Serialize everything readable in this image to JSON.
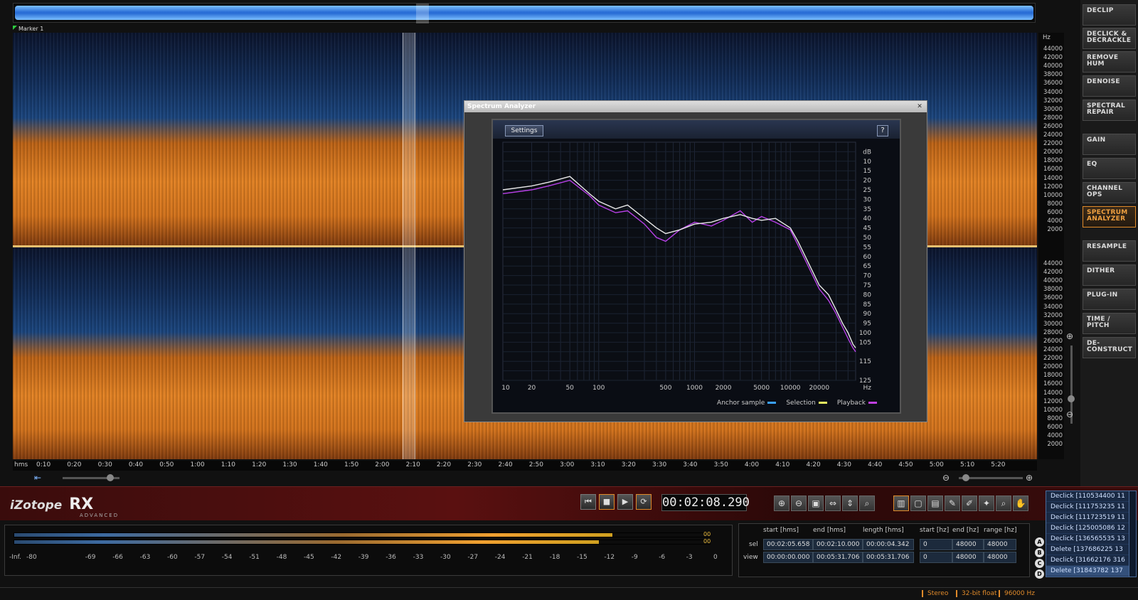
{
  "marker": {
    "label": "Marker 1"
  },
  "hz_scale": {
    "unit": "Hz",
    "ticks": [
      "44000",
      "42000",
      "40000",
      "38000",
      "36000",
      "34000",
      "32000",
      "30000",
      "28000",
      "26000",
      "24000",
      "22000",
      "20000",
      "18000",
      "16000",
      "14000",
      "12000",
      "10000",
      "8000",
      "6000",
      "4000",
      "2000"
    ]
  },
  "timeline": {
    "unit": "hms",
    "ticks": [
      "0:10",
      "0:20",
      "0:30",
      "0:40",
      "0:50",
      "1:00",
      "1:10",
      "1:20",
      "1:30",
      "1:40",
      "1:50",
      "2:00",
      "2:10",
      "2:20",
      "2:30",
      "2:40",
      "2:50",
      "3:00",
      "3:10",
      "3:20",
      "3:30",
      "3:40",
      "3:50",
      "4:00",
      "4:10",
      "4:20",
      "4:30",
      "4:40",
      "4:50",
      "5:00",
      "5:10",
      "5:20"
    ]
  },
  "modules": [
    {
      "label": "DECLIP"
    },
    {
      "label": "DECLICK & DECRACKLE"
    },
    {
      "label": "REMOVE HUM"
    },
    {
      "label": "DENOISE"
    },
    {
      "label": "SPECTRAL REPAIR"
    },
    {
      "label": "GAIN"
    },
    {
      "label": "EQ"
    },
    {
      "label": "CHANNEL OPS"
    },
    {
      "label": "SPECTRUM ANALYZER",
      "active": true
    },
    {
      "label": "RESAMPLE"
    },
    {
      "label": "DITHER"
    },
    {
      "label": "PLUG-IN"
    },
    {
      "label": "TIME / PITCH"
    },
    {
      "label": "DE-CONSTRUCT"
    }
  ],
  "branding": {
    "brand": "iZotope",
    "product": "RX",
    "edition": "ADVANCED"
  },
  "transport": {
    "time": "00:02:08.290"
  },
  "meter": {
    "ticks": [
      "-Inf.",
      "-80",
      "-69",
      "-66",
      "-63",
      "-60",
      "-57",
      "-54",
      "-51",
      "-48",
      "-45",
      "-42",
      "-39",
      "-36",
      "-33",
      "-30",
      "-27",
      "-24",
      "-21",
      "-18",
      "-15",
      "-12",
      "-9",
      "-6",
      "-3",
      "0"
    ],
    "peak_left": "00",
    "peak_right": "00",
    "level_left": 0.86,
    "level_right": 0.84
  },
  "selection_info": {
    "headers": {
      "start_hms": "start [hms]",
      "end_hms": "end [hms]",
      "length_hms": "length [hms]",
      "start_hz": "start [hz]",
      "end_hz": "end [hz]",
      "range_hz": "range [hz]"
    },
    "sel": {
      "label": "sel",
      "start": "00:02:05.658",
      "end": "00:02:10.000",
      "length": "00:00:04.342",
      "start_hz": "0",
      "end_hz": "48000",
      "range_hz": "48000"
    },
    "view": {
      "label": "view",
      "start": "00:00:00.000",
      "end": "00:05:31.706",
      "length": "00:05:31.706",
      "start_hz": "0",
      "end_hz": "48000",
      "range_hz": "48000"
    }
  },
  "abcd": [
    "A",
    "B",
    "C",
    "D"
  ],
  "history": [
    "Declick [110534400 11",
    "Declick [111753235 11",
    "Declick [111723519 11",
    "Declick [125005086 12",
    "Declick [136565535 13",
    "Delete [137686225 13",
    "Declick [31662176 316",
    "Delete [31843782 137"
  ],
  "status": {
    "channels": "Stereo",
    "bitdepth": "32-bit float",
    "samplerate": "96000 Hz"
  },
  "spectrum_analyzer": {
    "title": "Spectrum Analyzer",
    "settings_label": "Settings",
    "help_label": "?",
    "legend": [
      {
        "label": "Anchor sample",
        "color": "#3aa0ff"
      },
      {
        "label": "Selection",
        "color": "#e8f060"
      },
      {
        "label": "Playback",
        "color": "#c040e0"
      }
    ]
  },
  "chart_data": {
    "type": "line",
    "x_scale": "log",
    "x_unit": "Hz",
    "y_unit": "dB",
    "xlim": [
      10,
      48000
    ],
    "ylim": [
      0,
      125
    ],
    "x_tick_labels": [
      "10",
      "20",
      "50",
      "100",
      "500",
      "1000",
      "2000",
      "5000",
      "10000",
      "20000"
    ],
    "y_tick_labels": [
      "10",
      "15",
      "20",
      "25",
      "30",
      "35",
      "40",
      "45",
      "50",
      "55",
      "60",
      "65",
      "70",
      "75",
      "80",
      "85",
      "90",
      "95",
      "100",
      "105",
      "115",
      "125"
    ],
    "grid": true,
    "series": [
      {
        "name": "Selection",
        "color": "#e8e8e8",
        "x": [
          10,
          20,
          30,
          50,
          80,
          100,
          150,
          200,
          300,
          400,
          500,
          700,
          1000,
          1500,
          2000,
          3000,
          4000,
          5000,
          7000,
          10000,
          12000,
          15000,
          20000,
          25000,
          30000,
          35000,
          40000,
          45000,
          48000
        ],
        "y": [
          25,
          23,
          21,
          18,
          27,
          31,
          35,
          33,
          40,
          45,
          48,
          46,
          43,
          42,
          40,
          38,
          40,
          41,
          40,
          45,
          52,
          62,
          75,
          80,
          88,
          95,
          100,
          106,
          108
        ]
      },
      {
        "name": "Playback",
        "color": "#b840e8",
        "x": [
          10,
          20,
          30,
          50,
          80,
          100,
          150,
          200,
          300,
          400,
          500,
          700,
          1000,
          1500,
          2000,
          3000,
          4000,
          5000,
          7000,
          10000,
          12000,
          15000,
          20000,
          25000,
          30000,
          35000,
          40000,
          45000,
          48000
        ],
        "y": [
          27,
          25,
          23,
          20,
          28,
          33,
          37,
          36,
          43,
          50,
          52,
          46,
          42,
          44,
          41,
          36,
          42,
          39,
          42,
          46,
          54,
          64,
          77,
          83,
          90,
          97,
          103,
          108,
          110
        ]
      }
    ]
  }
}
